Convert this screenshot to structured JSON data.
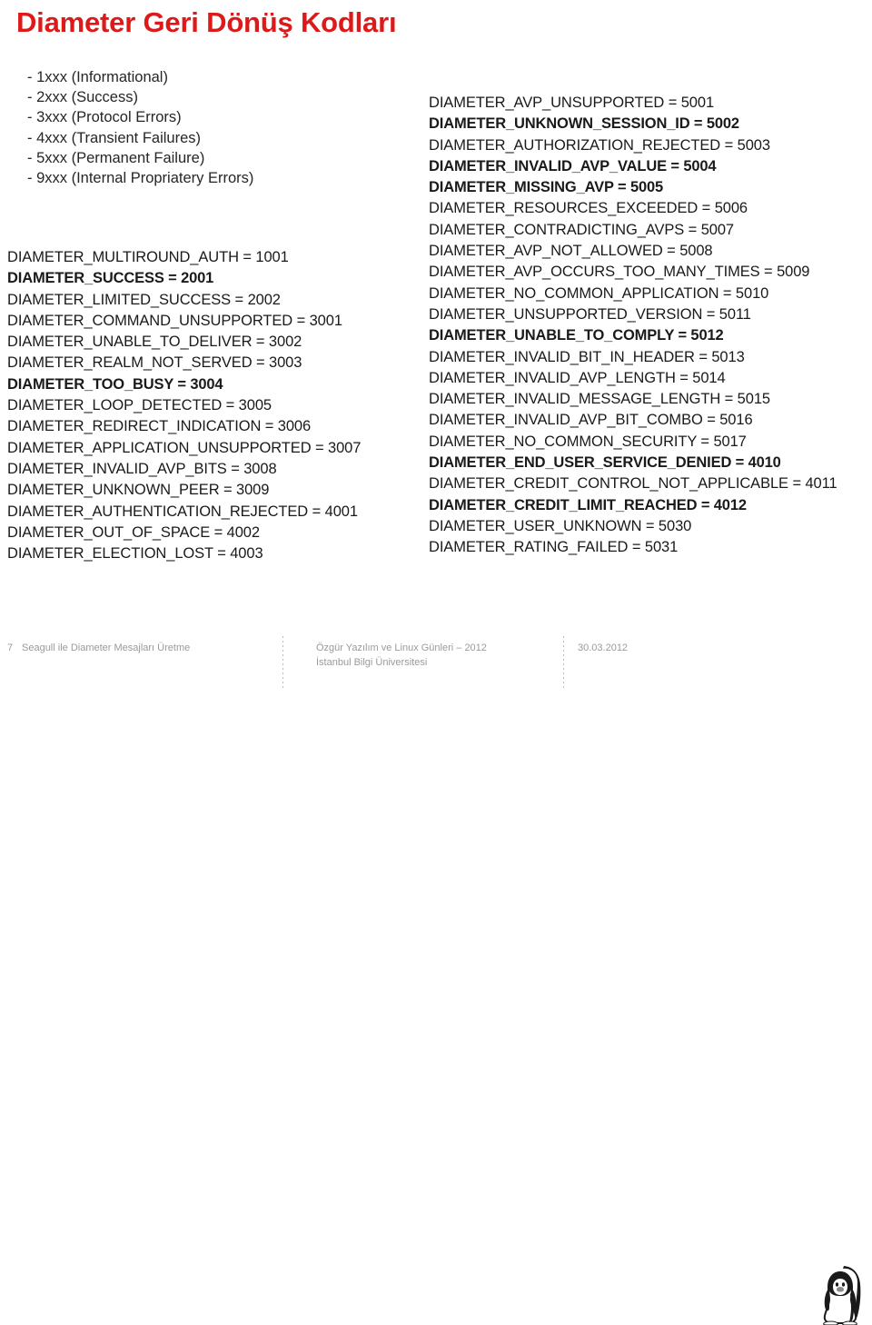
{
  "slide": {
    "title": "Diameter Geri Dönüş Kodları",
    "title_color": "#dd1a1a"
  },
  "ranges": [
    {
      "text": "- 1xxx (Informational)"
    },
    {
      "text": "- 2xxx (Success)"
    },
    {
      "text": "- 3xxx (Protocol Errors)"
    },
    {
      "text": "- 4xxx (Transient Failures)"
    },
    {
      "text": "- 5xxx (Permanent Failure)"
    },
    {
      "text": "- 9xxx (Internal Propriatery Errors)"
    }
  ],
  "left_codes": [
    {
      "text": "DIAMETER_MULTIROUND_AUTH = 1001",
      "bold": false
    },
    {
      "text": "DIAMETER_SUCCESS = 2001",
      "bold": true
    },
    {
      "text": "DIAMETER_LIMITED_SUCCESS = 2002",
      "bold": false
    },
    {
      "text": "DIAMETER_COMMAND_UNSUPPORTED = 3001",
      "bold": false
    },
    {
      "text": "DIAMETER_UNABLE_TO_DELIVER = 3002",
      "bold": false
    },
    {
      "text": "DIAMETER_REALM_NOT_SERVED = 3003",
      "bold": false
    },
    {
      "text": "DIAMETER_TOO_BUSY = 3004",
      "bold": true
    },
    {
      "text": "DIAMETER_LOOP_DETECTED = 3005",
      "bold": false
    },
    {
      "text": "DIAMETER_REDIRECT_INDICATION = 3006",
      "bold": false
    },
    {
      "text": "DIAMETER_APPLICATION_UNSUPPORTED = 3007",
      "bold": false
    },
    {
      "text": "DIAMETER_INVALID_AVP_BITS = 3008",
      "bold": false
    },
    {
      "text": "DIAMETER_UNKNOWN_PEER = 3009",
      "bold": false
    },
    {
      "text": "DIAMETER_AUTHENTICATION_REJECTED = 4001",
      "bold": false
    },
    {
      "text": "DIAMETER_OUT_OF_SPACE = 4002",
      "bold": false
    },
    {
      "text": "DIAMETER_ELECTION_LOST = 4003",
      "bold": false
    }
  ],
  "right_codes": [
    {
      "text": "DIAMETER_AVP_UNSUPPORTED = 5001",
      "bold": false
    },
    {
      "text": "DIAMETER_UNKNOWN_SESSION_ID = 5002",
      "bold": true
    },
    {
      "text": "DIAMETER_AUTHORIZATION_REJECTED = 5003",
      "bold": false
    },
    {
      "text": "DIAMETER_INVALID_AVP_VALUE = 5004",
      "bold": true
    },
    {
      "text": "DIAMETER_MISSING_AVP = 5005",
      "bold": true
    },
    {
      "text": "DIAMETER_RESOURCES_EXCEEDED = 5006",
      "bold": false
    },
    {
      "text": "DIAMETER_CONTRADICTING_AVPS = 5007",
      "bold": false
    },
    {
      "text": "DIAMETER_AVP_NOT_ALLOWED = 5008",
      "bold": false
    },
    {
      "text": "DIAMETER_AVP_OCCURS_TOO_MANY_TIMES = 5009",
      "bold": false
    },
    {
      "text": "DIAMETER_NO_COMMON_APPLICATION = 5010",
      "bold": false
    },
    {
      "text": "DIAMETER_UNSUPPORTED_VERSION = 5011",
      "bold": false
    },
    {
      "text": "DIAMETER_UNABLE_TO_COMPLY = 5012",
      "bold": true
    },
    {
      "text": "DIAMETER_INVALID_BIT_IN_HEADER = 5013",
      "bold": false
    },
    {
      "text": "DIAMETER_INVALID_AVP_LENGTH = 5014",
      "bold": false
    },
    {
      "text": "DIAMETER_INVALID_MESSAGE_LENGTH = 5015",
      "bold": false
    },
    {
      "text": "DIAMETER_INVALID_AVP_BIT_COMBO = 5016",
      "bold": false
    },
    {
      "text": "DIAMETER_NO_COMMON_SECURITY = 5017",
      "bold": false
    },
    {
      "text": "DIAMETER_END_USER_SERVICE_DENIED = 4010",
      "bold": true
    },
    {
      "text": "DIAMETER_CREDIT_CONTROL_NOT_APPLICABLE = 4011",
      "bold": false
    },
    {
      "text": "DIAMETER_CREDIT_LIMIT_REACHED = 4012",
      "bold": true
    },
    {
      "text": "DIAMETER_USER_UNKNOWN = 5030",
      "bold": false
    },
    {
      "text": "DIAMETER_RATING_FAILED = 5031",
      "bold": false
    }
  ],
  "footer": {
    "page_number": "7",
    "presentation_title": "Seagull ile Diameter Mesajları Üretme",
    "event_line1": "Özgür Yazılım ve Linux Günleri – 2012",
    "event_line2": "İstanbul Bilgi Üniversitesi",
    "date": "30.03.2012",
    "logo": "penguin-logo"
  }
}
